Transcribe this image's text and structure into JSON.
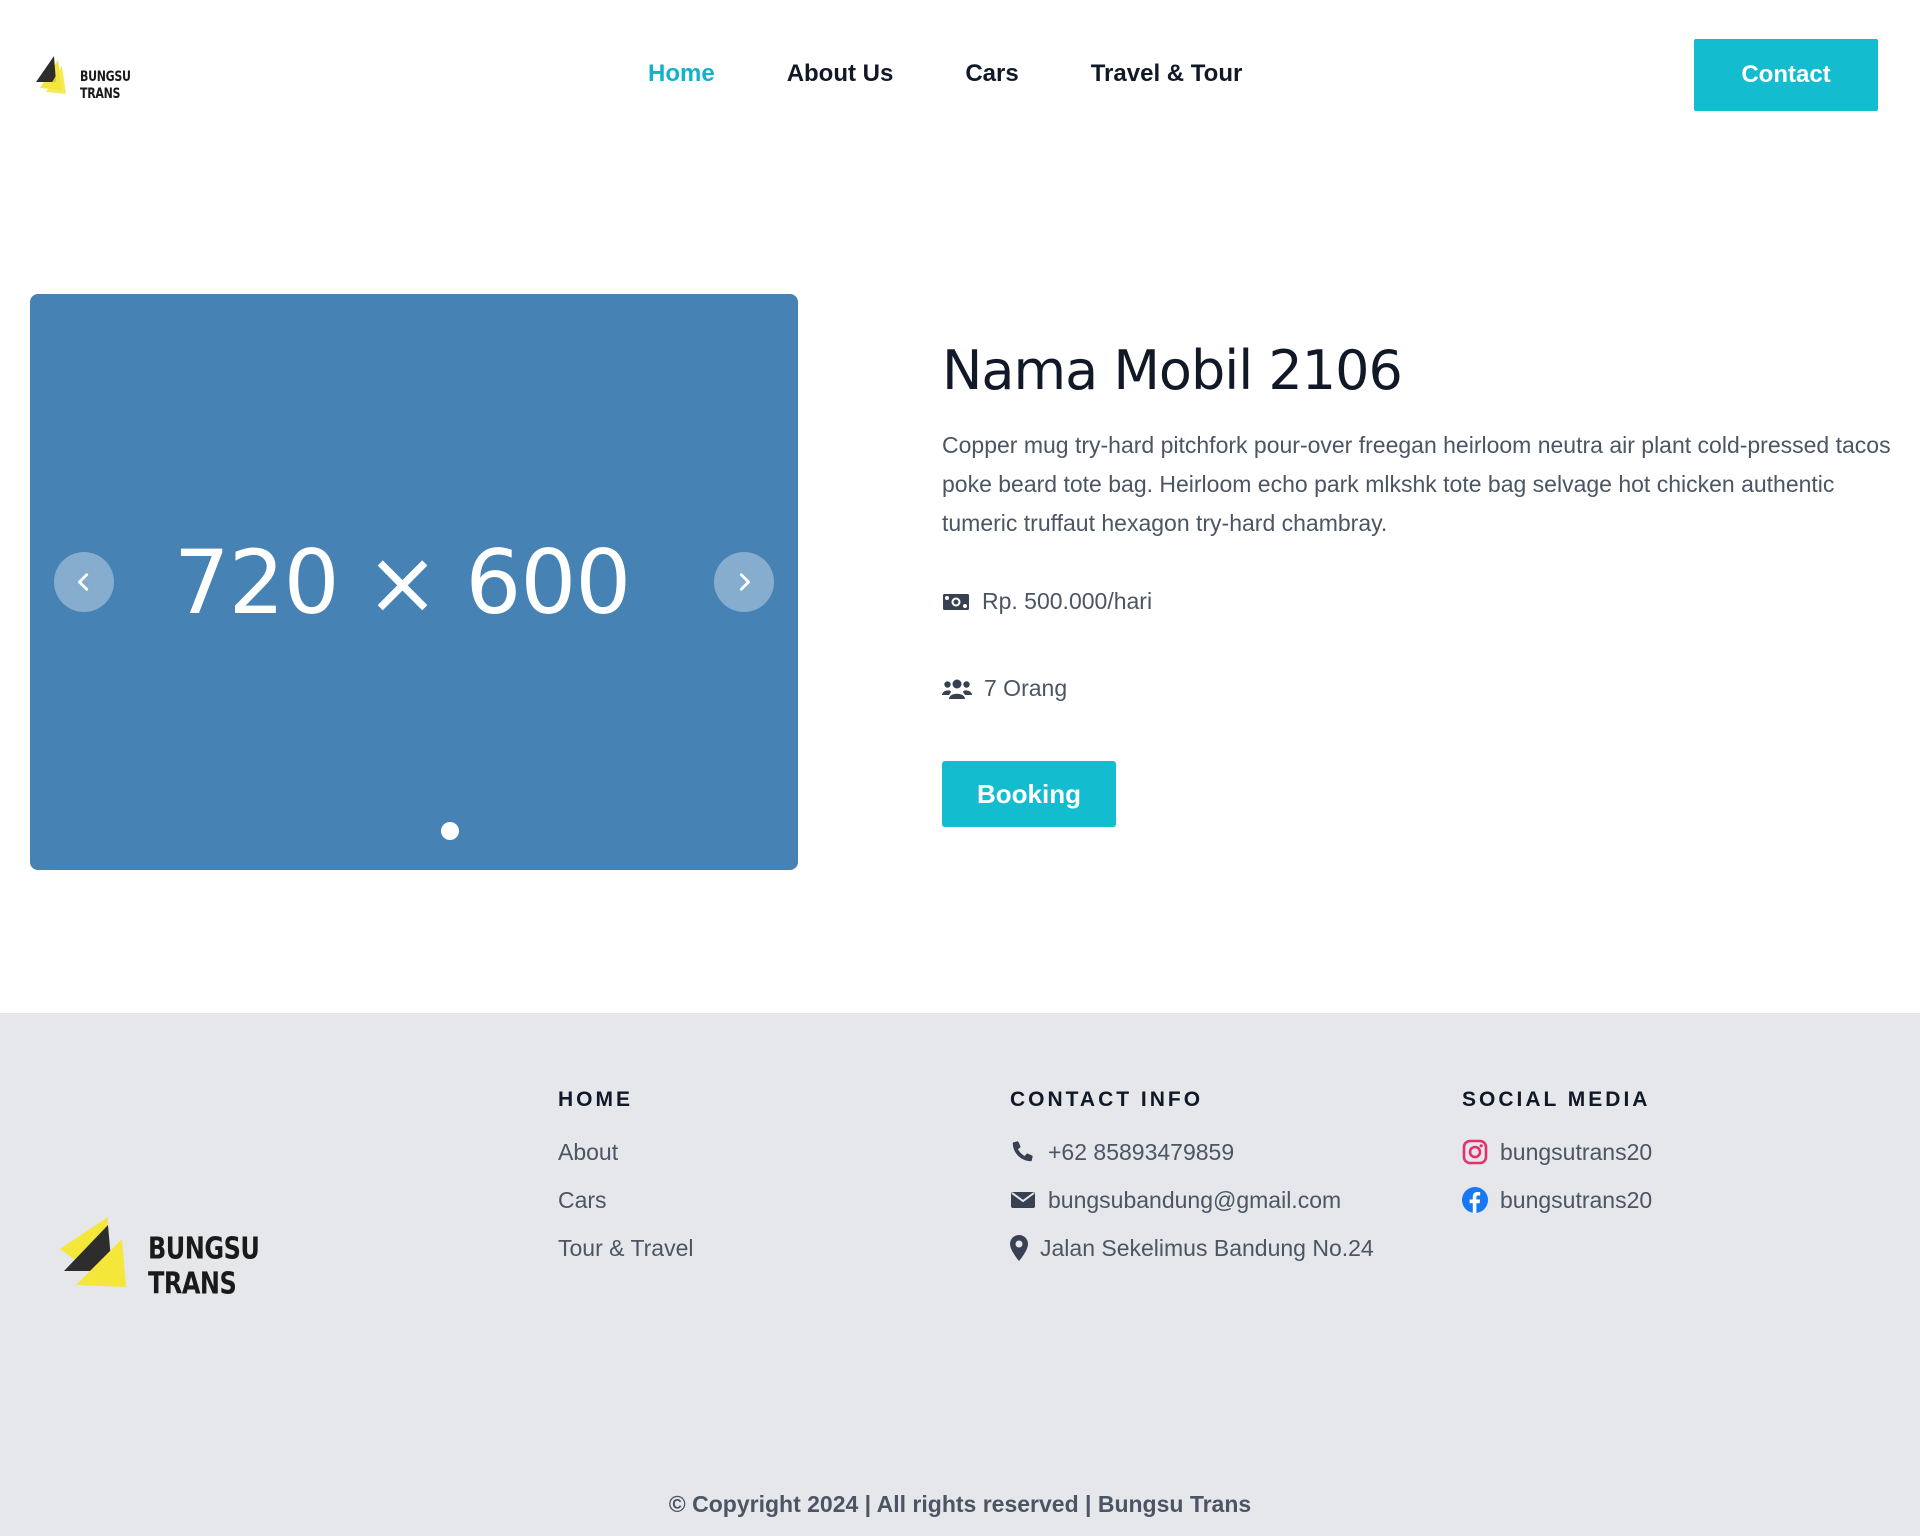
{
  "header": {
    "logo_text": "BUNGSU TRANS",
    "nav": [
      {
        "label": "Home",
        "active": true
      },
      {
        "label": "About Us",
        "active": false
      },
      {
        "label": "Cars",
        "active": false
      },
      {
        "label": "Travel & Tour",
        "active": false
      }
    ],
    "contact_label": "Contact"
  },
  "carousel": {
    "placeholder_text": "720 × 600",
    "prev_icon": "chevron-left-icon",
    "next_icon": "chevron-right-icon",
    "slide_count": 1,
    "active_slide": 1
  },
  "car": {
    "title": "Nama Mobil 2106",
    "description": "Copper mug try-hard pitchfork pour-over freegan heirloom neutra air plant cold-pressed tacos poke beard tote bag. Heirloom echo park mlkshk tote bag selvage hot chicken authentic tumeric truffaut hexagon try-hard chambray.",
    "price": "Rp. 500.000/hari",
    "price_icon": "money-bill-icon",
    "capacity": "7 Orang",
    "capacity_icon": "users-icon",
    "booking_label": "Booking"
  },
  "footer": {
    "logo_text": "BUNGSU TRANS",
    "home": {
      "heading": "HOME",
      "links": [
        "About",
        "Cars",
        "Tour & Travel"
      ]
    },
    "contact": {
      "heading": "CONTACT INFO",
      "phone": "+62 85893479859",
      "email": "bungsubandung@gmail.com",
      "address": "Jalan Sekelimus Bandung No.24"
    },
    "social": {
      "heading": "SOCIAL MEDIA",
      "instagram": "bungsutrans20",
      "facebook": "bungsutrans20"
    },
    "copyright": "© Copyright 2024 | All rights reserved | Bungsu Trans"
  },
  "colors": {
    "accent": "#14bccf",
    "active_nav": "#14b2c9",
    "carousel_bg": "#4682b4",
    "footer_bg": "#e5e7eb",
    "instagram": "#e1306c",
    "facebook": "#1877f2"
  }
}
